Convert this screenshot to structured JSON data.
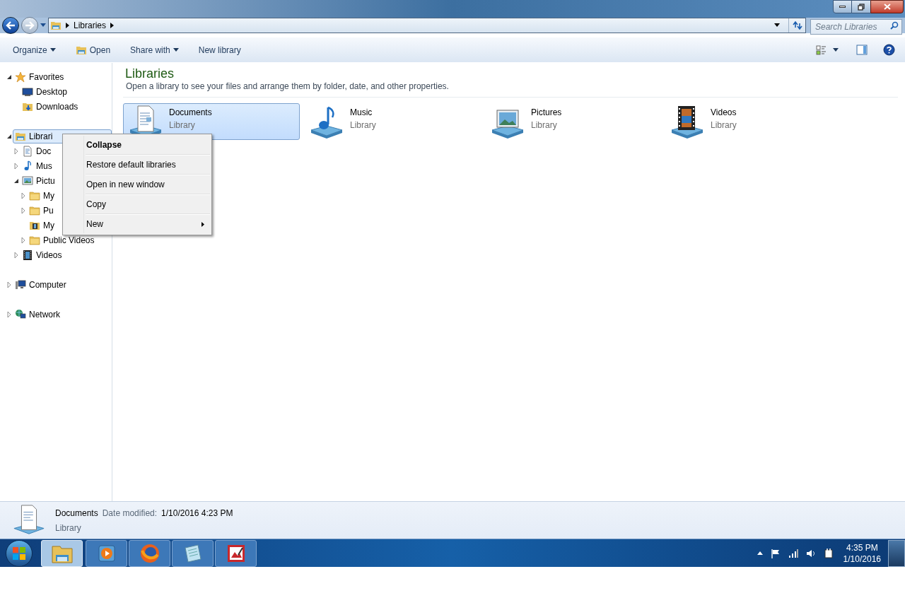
{
  "window": {
    "controls": [
      {
        "kind": "minimize"
      },
      {
        "kind": "restore"
      },
      {
        "kind": "close"
      }
    ]
  },
  "address": {
    "crumbs": [
      "Libraries"
    ],
    "search": {
      "placeholder": "Search Libraries"
    }
  },
  "toolbar": {
    "items": [
      {
        "label": "Organize",
        "kind": "dropdown"
      },
      {
        "label": "Open",
        "kind": "folder"
      },
      {
        "label": "Share with",
        "kind": "dropdown"
      },
      {
        "label": "New library",
        "kind": "plain"
      }
    ]
  },
  "sidebar": {
    "groups": [
      {
        "label": "Favorites",
        "kind": "star",
        "expanded": true,
        "selected": false,
        "children": [
          {
            "label": "Desktop",
            "kind": "desktop",
            "selected": false
          },
          {
            "label": "Downloads",
            "kind": "download",
            "selected": false
          }
        ]
      },
      {
        "label": "Librari",
        "kind": "library",
        "expanded": true,
        "selected": true,
        "children": [
          {
            "label": "Doc",
            "kind": "document",
            "expanded": false,
            "selected": false
          },
          {
            "label": "Mus",
            "kind": "music",
            "expanded": false,
            "selected": false
          },
          {
            "label": "Pictu",
            "kind": "picture",
            "expanded": true,
            "selected": false,
            "children": [
              {
                "label": "My",
                "kind": "folder",
                "expanded": false,
                "selected": false
              },
              {
                "label": "Pu",
                "kind": "folder",
                "expanded": false,
                "selected": false
              },
              {
                "label": "My",
                "kind": "video",
                "selected": false
              },
              {
                "label": "Public Videos",
                "kind": "folder",
                "expanded": false,
                "selected": false
              }
            ]
          },
          {
            "label": "Videos",
            "kind": "film",
            "expanded": false,
            "selected": false
          }
        ]
      },
      {
        "label": "Computer",
        "kind": "computer",
        "expanded": false,
        "selected": false
      },
      {
        "label": "Network",
        "kind": "network",
        "expanded": false,
        "selected": false
      }
    ]
  },
  "content": {
    "title": "Libraries",
    "subtitle": "Open a library to see your files and arrange them by folder, date, and other properties.",
    "libraries": [
      {
        "name": "Documents",
        "type": "Library",
        "kind": "document",
        "selected": true
      },
      {
        "name": "Music",
        "type": "Library",
        "kind": "music",
        "selected": false
      },
      {
        "name": "Pictures",
        "type": "Library",
        "kind": "picture",
        "selected": false
      },
      {
        "name": "Videos",
        "type": "Library",
        "kind": "film",
        "selected": false
      }
    ]
  },
  "context_menu": {
    "items": [
      {
        "label": "Collapse",
        "default": true,
        "submenu": false
      },
      {
        "label": "Restore default libraries",
        "default": false,
        "submenu": false
      },
      {
        "label": "Open in new window",
        "default": false,
        "submenu": false
      },
      {
        "label": "Copy",
        "default": false,
        "submenu": false
      },
      {
        "label": "New",
        "default": false,
        "submenu": true
      }
    ]
  },
  "details": {
    "name": "Documents",
    "date_label": "Date modified:",
    "date": "1/10/2016 4:23 PM",
    "type": "Library"
  },
  "taskbar": {
    "apps": [
      {
        "kind": "explorer",
        "selected": true
      },
      {
        "kind": "media",
        "selected": false
      },
      {
        "kind": "browser",
        "selected": false
      },
      {
        "kind": "notepad",
        "selected": false
      },
      {
        "kind": "paint",
        "selected": false
      }
    ],
    "time": "4:35 PM",
    "date": "1/10/2016"
  }
}
